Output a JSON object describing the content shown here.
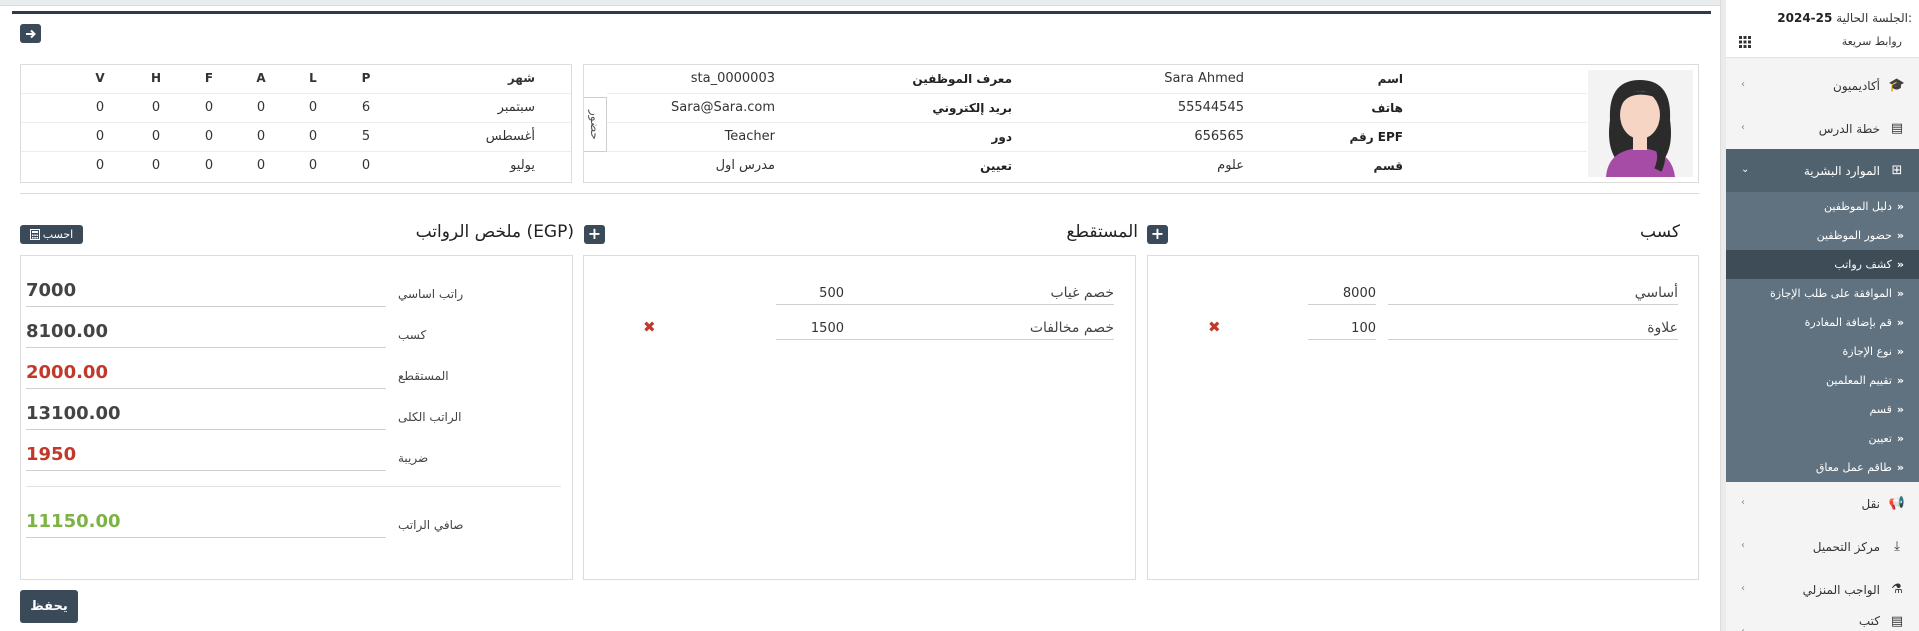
{
  "sidebar": {
    "session_label": "الجلسة الحالية:",
    "session_value": "2024-25",
    "quick_links": "روابط سريعة",
    "items": [
      {
        "label": "أكاديميون",
        "icon": "graduation-cap-icon"
      },
      {
        "label": "خطة الدرس",
        "icon": "book-icon"
      },
      {
        "label": "الموارد البشرية",
        "icon": "sitemap-icon"
      },
      {
        "label": "نقل",
        "icon": "bullhorn-icon"
      },
      {
        "label": "مركز التحميل",
        "icon": "download-icon"
      },
      {
        "label": "الواجب المنزلي",
        "icon": "flask-icon"
      },
      {
        "label": "كتب",
        "icon": "book-icon"
      }
    ],
    "hr_subitems": [
      "دليل الموظفين",
      "حضور الموظفين",
      "كشف رواتب",
      "الموافقة على طلب الإجازة",
      "قم بإضافة المغادرة",
      "نوع الإجازة",
      "تقييم المعلمين",
      "قسم",
      "تعيين",
      "طاقم عمل معاق"
    ]
  },
  "profile": {
    "labels": {
      "name": "اسم",
      "phone": "هاتف",
      "epf": "رقم EPF",
      "department": "قسم",
      "staff_id": "معرف الموظفين",
      "email": "بريد إلكتروني",
      "role": "دور",
      "designation": "تعيين"
    },
    "name": "Sara Ahmed",
    "phone": "55544545",
    "epf": "656565",
    "department": "علوم",
    "staff_id": "sta_0000003",
    "email": "Sara@Sara.com",
    "role": "Teacher",
    "designation": "مدرس اول",
    "attendance_tab": "حضور"
  },
  "attendance": {
    "month_header": "شهر",
    "headers": [
      "P",
      "L",
      "A",
      "F",
      "H",
      "V"
    ],
    "rows": [
      {
        "month": "سبتمبر",
        "values": [
          "6",
          "0",
          "0",
          "0",
          "0",
          "0"
        ]
      },
      {
        "month": "أغسطس",
        "values": [
          "5",
          "0",
          "0",
          "0",
          "0",
          "0"
        ]
      },
      {
        "month": "يوليو",
        "values": [
          "0",
          "0",
          "0",
          "0",
          "0",
          "0"
        ]
      }
    ]
  },
  "earnings": {
    "title": "كسب",
    "rows": [
      {
        "label": "أساسي",
        "value": "8000"
      },
      {
        "label": "علاوة",
        "value": "100"
      }
    ]
  },
  "deductions": {
    "title": "المستقطع",
    "rows": [
      {
        "label": "خصم غياب",
        "value": "500"
      },
      {
        "label": "خصم مخالفات",
        "value": "1500"
      }
    ]
  },
  "summary": {
    "title": "ملخص الرواتب (EGP)",
    "calculate_label": "احسب",
    "rows": [
      {
        "label": "راتب اساسي",
        "value": "7000"
      },
      {
        "label": "كسب",
        "value": "8100.00"
      },
      {
        "label": "المستقطع",
        "value": "2000.00"
      },
      {
        "label": "الراتب الكلى",
        "value": "13100.00"
      },
      {
        "label": "ضريبة",
        "value": "1950"
      },
      {
        "label": "صافي الراتب",
        "value": "11150.00"
      }
    ]
  },
  "save_label": "يحفظ",
  "colors": {
    "accent": "#3b4a59",
    "sidebar_active": "#51626f",
    "sidebar_sub": "#607280",
    "negative": "#c0392b",
    "positive": "#7cb342"
  }
}
